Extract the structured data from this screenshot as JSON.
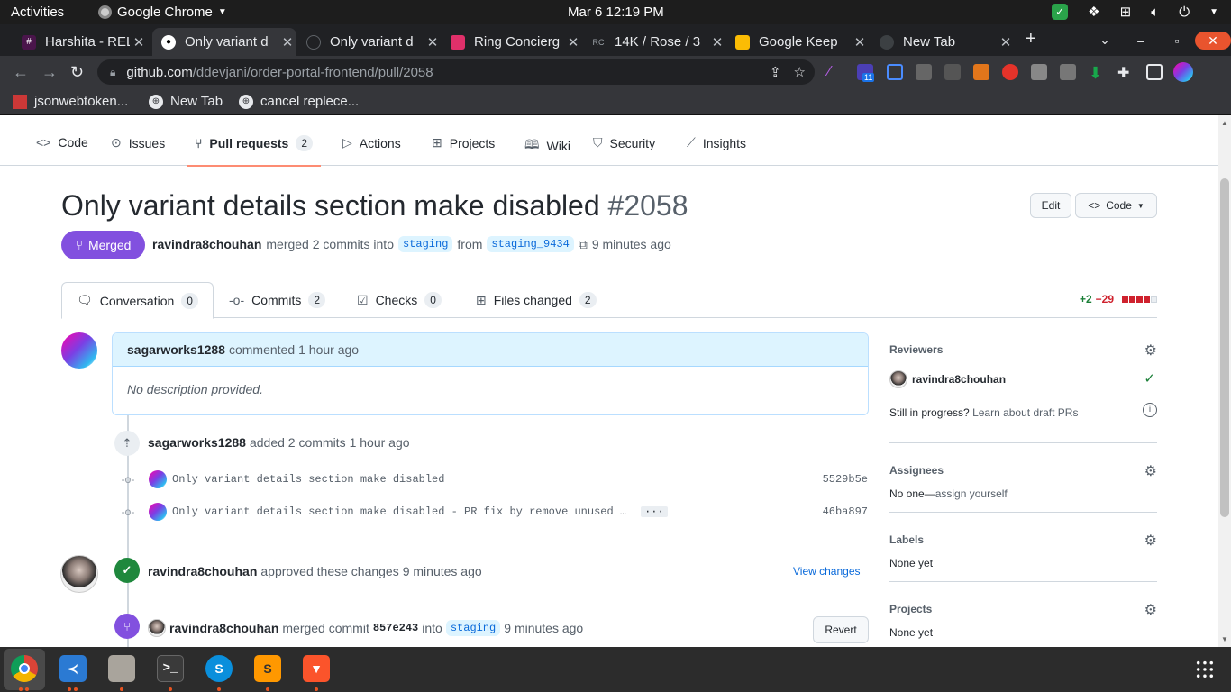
{
  "system": {
    "activities": "Activities",
    "app_name": "Google Chrome",
    "clock": "Mar 6  12:19 PM"
  },
  "browser": {
    "tabs": [
      {
        "title": "Harshita - REL",
        "icon": "slack-icon"
      },
      {
        "title": "Only variant d",
        "icon": "github-icon"
      },
      {
        "title": "Only variant d",
        "icon": "github-icon"
      },
      {
        "title": "Ring Concierg",
        "icon": "ring-icon"
      },
      {
        "title": "14K / Rose / 3",
        "icon": "rc-icon"
      },
      {
        "title": "Google Keep",
        "icon": "keep-icon"
      },
      {
        "title": "New Tab",
        "icon": "chrome-icon"
      }
    ],
    "url_host": "github.com",
    "url_path": "/ddevjani/order-portal-frontend/pull/2058",
    "extension_badge": "11",
    "bookmarks": [
      "jsonwebtoken...",
      "New Tab",
      "cancel replece..."
    ]
  },
  "repo_nav": {
    "items": [
      {
        "label": "Code",
        "icon": "code-icon"
      },
      {
        "label": "Issues",
        "icon": "issue-icon"
      },
      {
        "label": "Pull requests",
        "icon": "pull-request-icon",
        "count": "2"
      },
      {
        "label": "Actions",
        "icon": "play-icon"
      },
      {
        "label": "Projects",
        "icon": "table-icon"
      },
      {
        "label": "Wiki",
        "icon": "book-icon"
      },
      {
        "label": "Security",
        "icon": "shield-icon"
      },
      {
        "label": "Insights",
        "icon": "graph-icon"
      }
    ]
  },
  "pr": {
    "title": "Only variant details section make disabled",
    "number": "#2058",
    "edit_label": "Edit",
    "code_label": "Code",
    "state": "Merged",
    "author": "ravindra8chouhan",
    "merged_text": "merged 2 commits into",
    "base_branch": "staging",
    "from_text": "from",
    "head_branch": "staging_9434",
    "time": "9 minutes ago",
    "tabs": [
      {
        "label": "Conversation",
        "count": "0"
      },
      {
        "label": "Commits",
        "count": "2"
      },
      {
        "label": "Checks",
        "count": "0"
      },
      {
        "label": "Files changed",
        "count": "2"
      }
    ],
    "additions": "+2",
    "deletions": "−29"
  },
  "timeline": {
    "comment": {
      "author": "sagarworks1288",
      "action": "commented",
      "time": "1 hour ago",
      "body": "No description provided."
    },
    "commits_event": {
      "author": "sagarworks1288",
      "action": "added 2 commits",
      "time": "1 hour ago"
    },
    "commits": [
      {
        "message": "Only variant details section make disabled",
        "sha": "5529b5e"
      },
      {
        "message": "Only variant details section make disabled - PR fix by remove unused …",
        "sha": "46ba897",
        "more": "···"
      }
    ],
    "review": {
      "author": "ravindra8chouhan",
      "action": "approved these changes",
      "time": "9 minutes ago",
      "link": "View changes"
    },
    "merge": {
      "author": "ravindra8chouhan",
      "action": "merged commit",
      "commit": "857e243",
      "into": "into",
      "branch": "staging",
      "time": "9 minutes ago",
      "revert": "Revert"
    }
  },
  "sidebar": {
    "reviewers": {
      "heading": "Reviewers",
      "name": "ravindra8chouhan",
      "draft_q": "Still in progress?",
      "draft_link": "Learn about draft PRs"
    },
    "assignees": {
      "heading": "Assignees",
      "value": "No one—",
      "link": "assign yourself"
    },
    "labels": {
      "heading": "Labels",
      "value": "None yet"
    },
    "projects": {
      "heading": "Projects",
      "value": "None yet"
    }
  },
  "colors": {
    "merged": "#8250df",
    "approved": "#1a7f37",
    "link": "#0969da",
    "tab_underline": "#fd8c73"
  }
}
